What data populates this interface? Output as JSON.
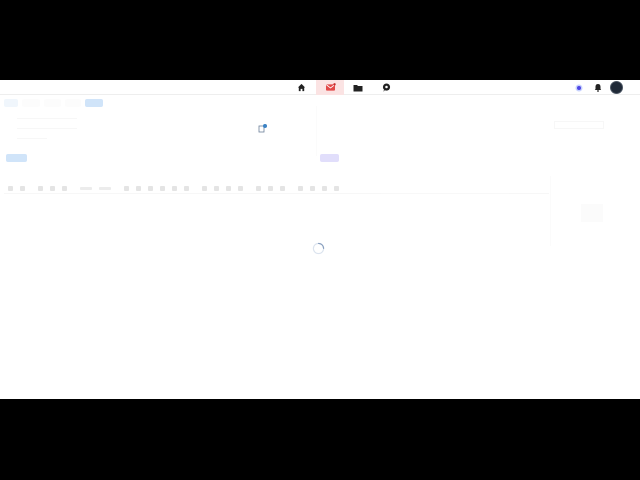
{
  "nav": {
    "icons": [
      "home-icon",
      "mail-icon",
      "folder-icon",
      "chat-icon",
      "notification-dot-icon",
      "bell-icon",
      "avatar"
    ]
  },
  "compose": {
    "tabs": [
      "",
      "",
      "",
      "",
      ""
    ],
    "rows": [
      {
        "label": "",
        "value": ""
      },
      {
        "label": "",
        "value": ""
      },
      {
        "label": "",
        "value": ""
      }
    ],
    "editor_placeholder": "",
    "side_label": ""
  },
  "status": {
    "loading": true
  },
  "colors": {
    "accent": "#2f8ae8",
    "mail_active_bg": "#fbe3e3",
    "mail_icon": "#e24848",
    "secondary_pill": "#7c6cf0"
  }
}
